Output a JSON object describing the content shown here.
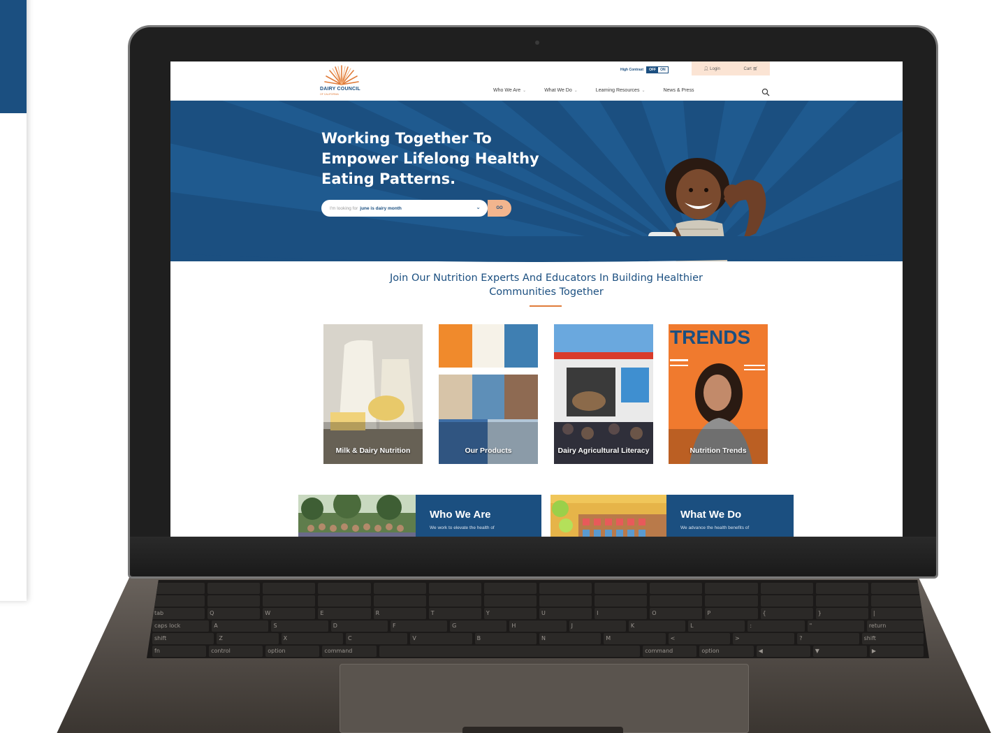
{
  "header": {
    "logo": {
      "name": "DAIRY COUNCIL",
      "sub": "OF CALIFORNIA"
    },
    "high_contrast_label": "High Contrast",
    "contrast_off": "OFF",
    "contrast_on": "ON",
    "login_label": "Login",
    "cart_label": "Cart",
    "nav": [
      {
        "label": "Who We Are"
      },
      {
        "label": "What We Do"
      },
      {
        "label": "Learning Resources"
      },
      {
        "label": "News & Press"
      }
    ]
  },
  "hero": {
    "headline": "Working Together To Empower Lifelong Healthy Eating Patterns.",
    "search_prefix": "I'm looking for",
    "search_value": "june is dairy month",
    "go_label": "GO"
  },
  "intro": {
    "title": "Join Our Nutrition Experts And Educators In Building Healthier Communities Together"
  },
  "tiles": [
    {
      "label": "Milk & Dairy Nutrition"
    },
    {
      "label": "Our Products"
    },
    {
      "label": "Dairy Agricultural Literacy"
    },
    {
      "label": "Nutrition Trends",
      "cover_text": "TRENDS"
    }
  ],
  "cards": [
    {
      "title": "Who We Are",
      "desc": "We work to elevate the health of"
    },
    {
      "title": "What We Do",
      "desc": "We advance the health benefits of"
    }
  ],
  "colors": {
    "brand_blue": "#1b4f80",
    "accent_orange": "#e07b39",
    "go_button": "#f2b58e"
  },
  "keyboard": {
    "row3": [
      "tab",
      "Q",
      "W",
      "E",
      "R",
      "T",
      "Y",
      "U",
      "I",
      "O",
      "P",
      "{",
      "}",
      "|"
    ],
    "row4": [
      "caps lock",
      "A",
      "S",
      "D",
      "F",
      "G",
      "H",
      "J",
      "K",
      "L",
      ":",
      "\"",
      "return"
    ],
    "row5": [
      "shift",
      "Z",
      "X",
      "C",
      "V",
      "B",
      "N",
      "M",
      "<",
      ">",
      "?",
      "shift"
    ],
    "row6": [
      "fn",
      "control",
      "option",
      "command",
      "",
      "command",
      "option",
      "◀",
      "▼",
      "▶"
    ]
  }
}
